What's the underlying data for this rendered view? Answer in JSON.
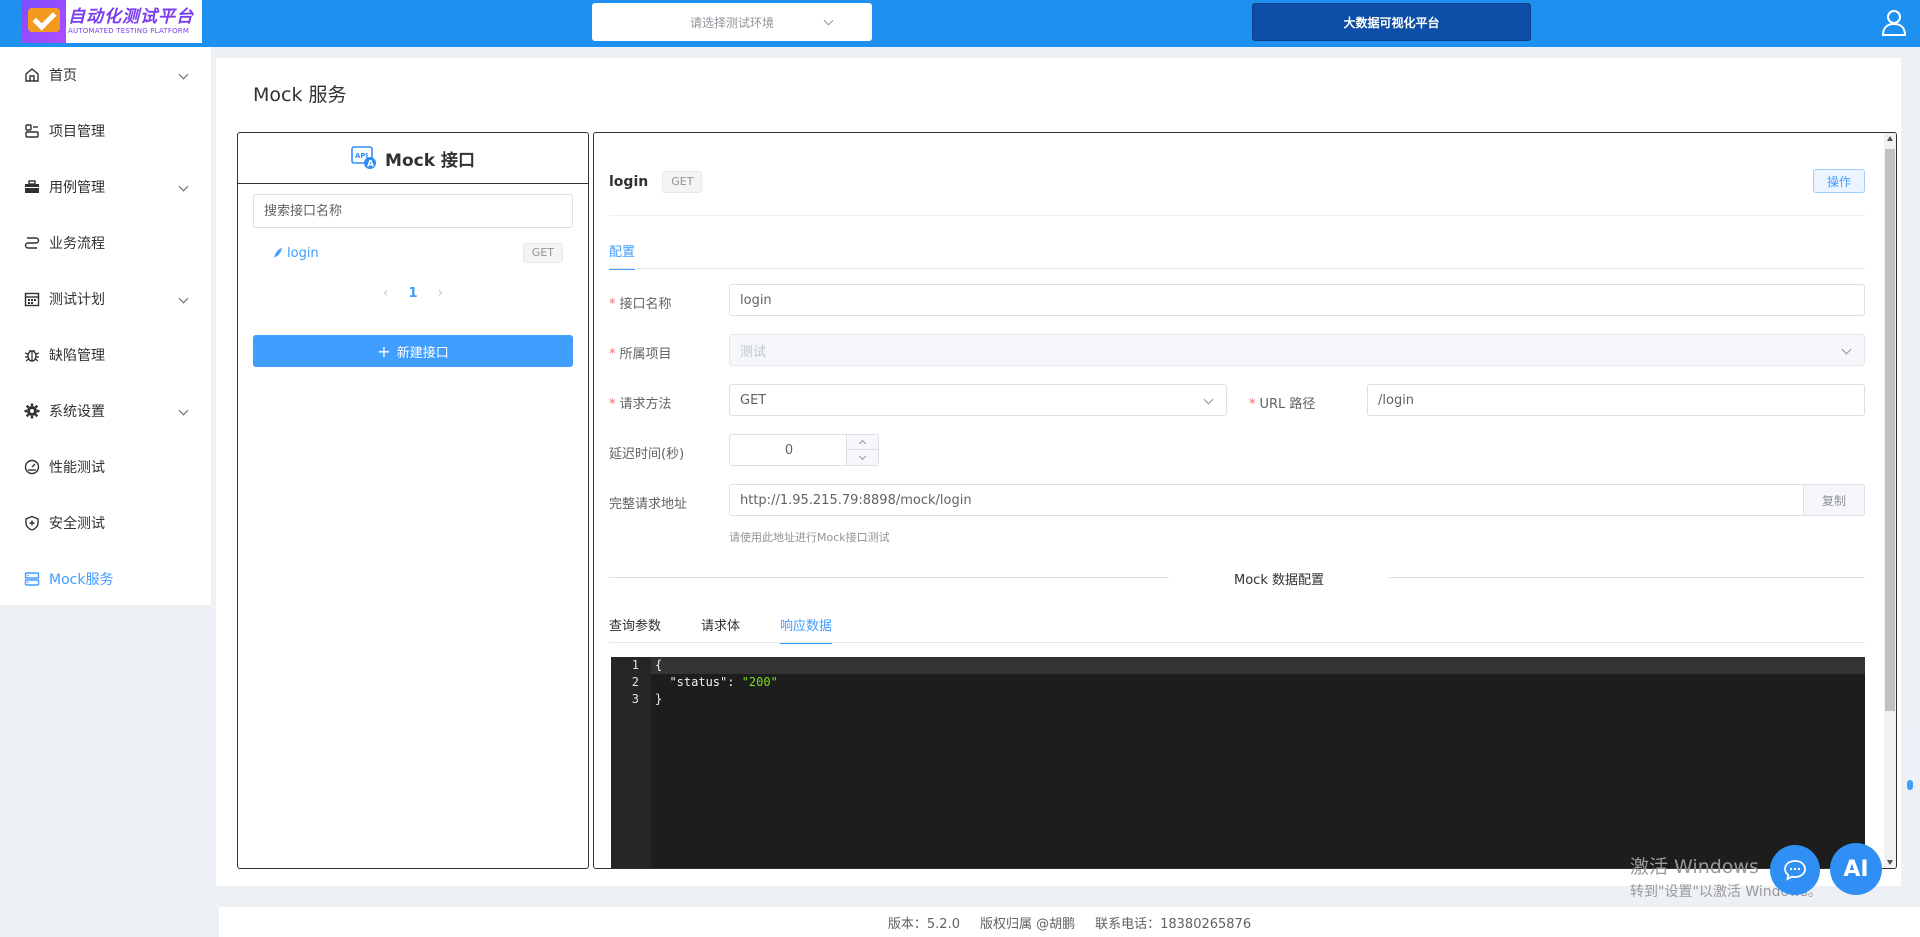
{
  "header": {
    "logo_title": "自动化测试平台",
    "logo_sub": "AUTOMATED TESTING PLATFORM",
    "env_placeholder": "请选择测试环境",
    "bigdata_label": "大数据可视化平台"
  },
  "sidebar": {
    "items": [
      {
        "label": "首页",
        "icon": "home-icon",
        "arrow": true
      },
      {
        "label": "项目管理",
        "icon": "project-icon",
        "arrow": false
      },
      {
        "label": "用例管理",
        "icon": "briefcase-icon",
        "arrow": true
      },
      {
        "label": "业务流程",
        "icon": "flow-icon",
        "arrow": false
      },
      {
        "label": "测试计划",
        "icon": "calendar-icon",
        "arrow": true
      },
      {
        "label": "缺陷管理",
        "icon": "bug-icon",
        "arrow": false
      },
      {
        "label": "系统设置",
        "icon": "gear-icon",
        "arrow": true
      },
      {
        "label": "性能测试",
        "icon": "gauge-icon",
        "arrow": false
      },
      {
        "label": "安全测试",
        "icon": "shield-icon",
        "arrow": false
      },
      {
        "label": "Mock服务",
        "icon": "server-icon",
        "arrow": false,
        "active": true
      }
    ]
  },
  "page": {
    "title": "Mock 服务"
  },
  "left_panel": {
    "header": "Mock 接口",
    "search_placeholder": "搜索接口名称",
    "apis": [
      {
        "name": "login",
        "method": "GET"
      }
    ],
    "page_current": "1",
    "new_button": "新建接口"
  },
  "detail": {
    "name": "login",
    "method": "GET",
    "op_button": "操作",
    "tab_config": "配置",
    "form": {
      "name_label": "接口名称",
      "name_value": "login",
      "project_label": "所属项目",
      "project_value": "测试",
      "method_label": "请求方法",
      "method_value": "GET",
      "url_label": "URL 路径",
      "url_value": "/login",
      "delay_label": "延迟时间(秒)",
      "delay_value": "0",
      "full_url_label": "完整请求地址",
      "full_url_value": "http://1.95.215.79:8898/mock/login",
      "copy_button": "复制",
      "hint": "请使用此地址进行Mock接口测试"
    },
    "divider": "Mock 数据配置",
    "data_tabs": [
      "查询参数",
      "请求体",
      "响应数据"
    ],
    "active_data_tab": 2,
    "editor": {
      "line_numbers": [
        "1",
        "2",
        "3"
      ],
      "lines": [
        "{",
        "  \"status\": \"200\"",
        "}"
      ],
      "key": "\"status\"",
      "sep": ": ",
      "value": "\"200\""
    }
  },
  "footer": {
    "version": "版本：5.2.0",
    "copyright": "版权归属 @胡鹏",
    "phone": "联系电话：18380265876"
  },
  "overlay": {
    "watermark_line1": "激活 Windows",
    "watermark_line2": "转到\"设置\"以激活 Windows。",
    "ai_label": "AI"
  },
  "colors": {
    "header_bg": "#1e90f0",
    "accent": "#409eff",
    "bigdata_bg": "#0d4fa8",
    "editor_bg": "#1d1d1d"
  }
}
